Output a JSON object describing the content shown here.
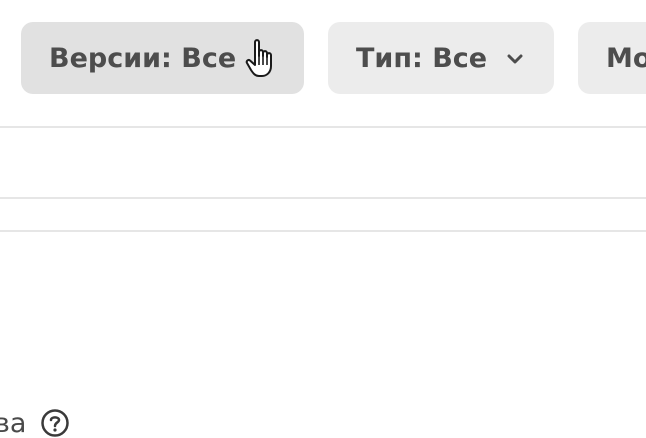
{
  "filters": {
    "versions_label": "Версии: Все",
    "type_label": "Тип: Все",
    "more_label": "Мо"
  },
  "footer": {
    "label_fragment": "ва"
  },
  "icons": {
    "chevron": "chevron-down-icon",
    "help": "help-circle-icon",
    "cursor": "hand-pointer-cursor"
  },
  "colors": {
    "button_bg": "#ececec",
    "button_bg_hover": "#e1e1e1",
    "text": "#4d4d4d",
    "divider": "#e6e6e6"
  }
}
